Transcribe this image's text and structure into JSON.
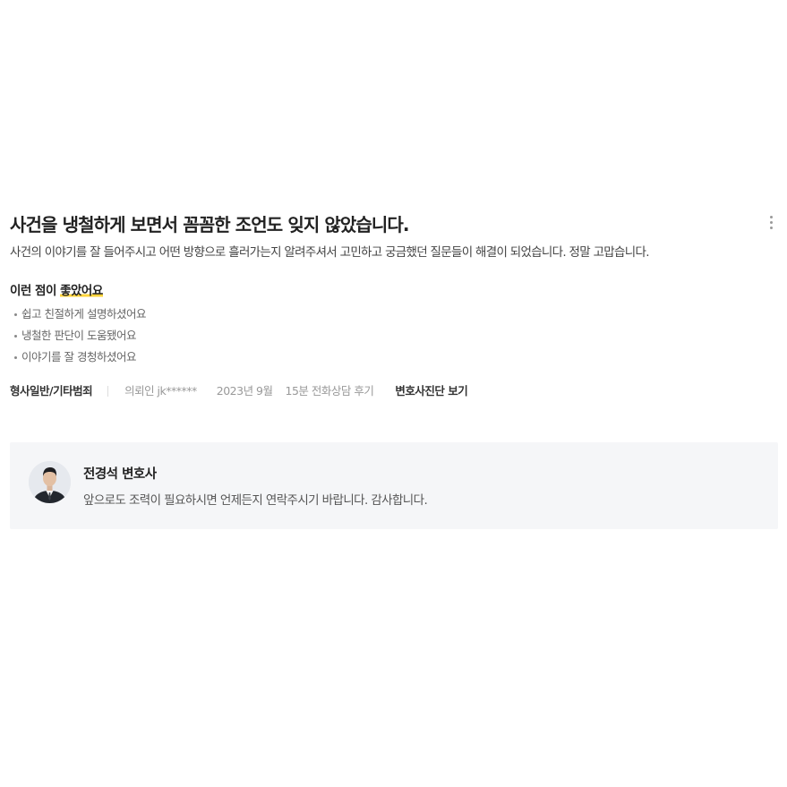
{
  "review": {
    "title": "사건을 냉철하게 보면서 꼼꼼한 조언도 잊지 않았습니다.",
    "body": "사건의 이야기를 잘 들어주시고 어떤 방향으로 흘러가는지 알려주셔서 고민하고 궁금했던 질문들이 해결이 되었습니다. 정말 고맙습니다.",
    "likes_heading_prefix": "이런 점이",
    "likes_heading_highlight": "좋았어요",
    "likes": [
      "쉽고 친절하게 설명하셨어요",
      "냉철한 판단이 도움됐어요",
      "이야기를 잘 경청하셨어요"
    ],
    "meta": {
      "category": "형사일반/기타범죄",
      "client": "의뢰인 jk******",
      "date": "2023년 9월",
      "consult": "15분 전화상담 후기",
      "diagnosis_link": "변호사진단 보기"
    },
    "more_icon": "more-vertical-icon"
  },
  "reply": {
    "lawyer_name": "전경석 변호사",
    "message": "앞으로도 조력이 필요하시면 언제든지 연락주시기 바랍니다. 감사합니다.",
    "avatar_icon": "lawyer-avatar"
  },
  "colors": {
    "highlight": "#ffd43b",
    "reply_background": "#f5f6f8",
    "meta_gray": "#999999"
  }
}
